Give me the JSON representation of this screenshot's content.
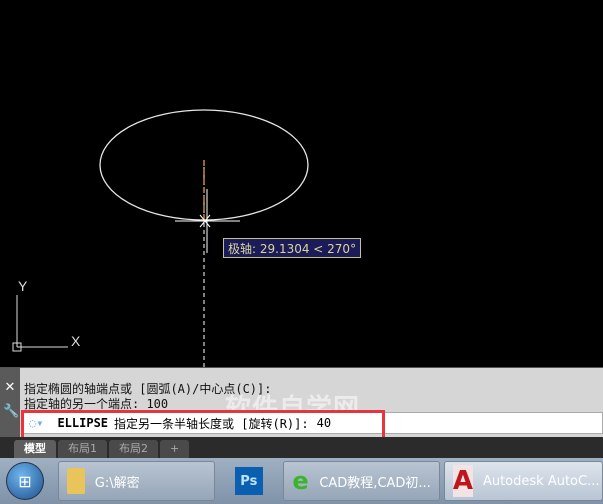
{
  "tooltip": "极轴: 29.1304 < 270°",
  "ucs": {
    "x": "X",
    "y": "Y"
  },
  "command": {
    "history": [
      "指定椭圆的轴端点或 [圆弧(A)/中心点(C)]:",
      "指定轴的另一个端点: 100"
    ],
    "name": "ELLIPSE",
    "prompt": "指定另一条半轴长度或 [旋转(R)]:",
    "value": "40"
  },
  "watermark": "软件自学网",
  "tabs": [
    "模型",
    "布局1",
    "布局2",
    "+"
  ],
  "taskbar": {
    "items": [
      {
        "label": "G:\\解密",
        "icon": "folder-icon"
      },
      {
        "label": "",
        "icon": "Ps"
      },
      {
        "label": "CAD教程,CAD初...",
        "icon": "ie-icon"
      },
      {
        "label": "Autodesk AutoC...",
        "icon": "A"
      }
    ]
  },
  "colors": {
    "highlight": "#e8343c",
    "tracking": "#f0a020"
  }
}
